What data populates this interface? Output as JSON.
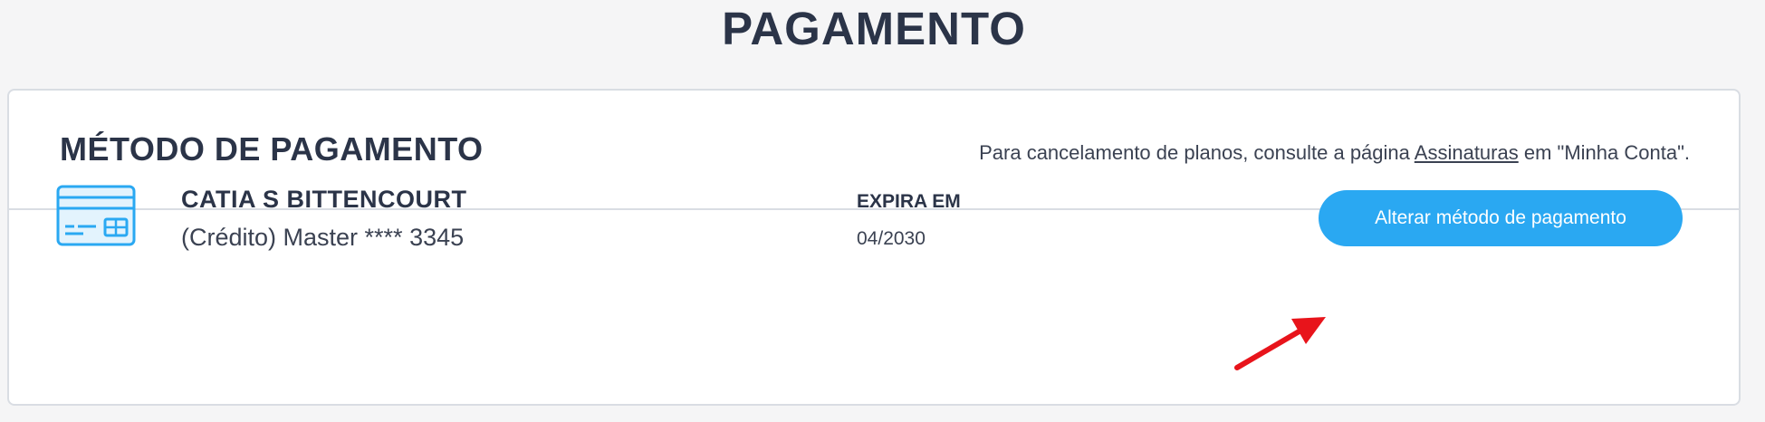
{
  "page": {
    "title": "PAGAMENTO"
  },
  "payment_method": {
    "section_title": "MÉTODO DE PAGAMENTO",
    "notice_prefix": "Para cancelamento de planos, consulte a página ",
    "notice_link": "Assinaturas",
    "notice_suffix": " em \"Minha Conta\"."
  },
  "card": {
    "icon": "credit-card-icon",
    "holder_name": "CATIA S BITTENCOURT",
    "description": "(Crédito) Master **** 3345",
    "expiry_label": "EXPIRA EM",
    "expiry_value": "04/2030",
    "change_button_label": "Alterar método de pagamento"
  },
  "annotation": {
    "icon": "red-arrow-icon",
    "color": "#e8141b"
  },
  "colors": {
    "accent": "#2aa8f2",
    "text": "#2b3448",
    "border": "#d9dde3",
    "background": "#f5f5f6"
  }
}
